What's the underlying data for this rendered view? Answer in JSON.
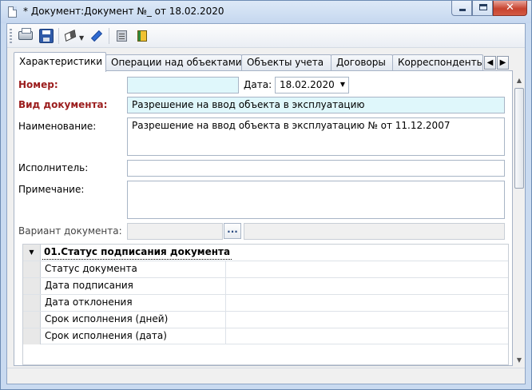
{
  "window": {
    "title": "* Документ:Документ №_ от 18.02.2020",
    "minimize_glyph": "",
    "maximize_glyph": "",
    "close_glyph": "✕"
  },
  "toolbar": {
    "items": [
      "print-icon",
      "save-icon",
      "eraser-icon",
      "pen-icon",
      "document-icon",
      "book-icon"
    ]
  },
  "tabs": [
    {
      "label": "Характеристики",
      "active": true
    },
    {
      "label": "Операции над объектами",
      "active": false
    },
    {
      "label": "Объекты учета",
      "active": false
    },
    {
      "label": "Договоры",
      "active": false
    },
    {
      "label": "Корреспонденты",
      "active": false
    }
  ],
  "tab_nav": {
    "prev": "◀",
    "next": "▶"
  },
  "form": {
    "number_label": "Номер:",
    "number_value": "",
    "date_label": "Дата:",
    "date_value": "18.02.2020",
    "date_arrow": "▼",
    "doc_type_label": "Вид документа:",
    "doc_type_value": "Разрешение на ввод объекта в эксплуатацию",
    "name_label": "Наименование:",
    "name_value": "Разрешение на ввод объекта в эксплуатацию № от 11.12.2007",
    "executor_label": "Исполнитель:",
    "executor_value": "",
    "note_label": "Примечание:",
    "note_value": "",
    "variant_label": "Вариант документа:",
    "variant_value": "",
    "variant_button": "...",
    "variant_extra": ""
  },
  "grid": {
    "expander": "▼",
    "group_title": "01.Статус подписания документа",
    "rows": [
      {
        "name": "Статус документа",
        "value": ""
      },
      {
        "name": "Дата подписания",
        "value": ""
      },
      {
        "name": "Дата отклонения",
        "value": ""
      },
      {
        "name": "Срок исполнения (дней)",
        "value": ""
      },
      {
        "name": "Срок исполнения (дата)",
        "value": ""
      }
    ]
  },
  "scrollbar": {
    "up": "▲",
    "down": "▼"
  }
}
